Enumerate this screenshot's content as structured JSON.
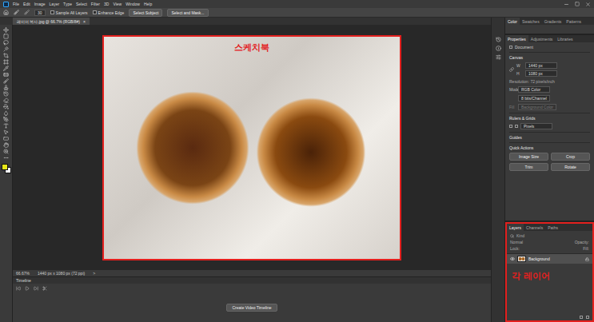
{
  "menu_bar": {
    "items": [
      "File",
      "Edit",
      "Image",
      "Layer",
      "Type",
      "Select",
      "Filter",
      "3D",
      "View",
      "Window",
      "Help"
    ]
  },
  "options_bar": {
    "size": "30",
    "checkboxes": [
      {
        "label": "Sample All Layers",
        "checked": false
      },
      {
        "label": "Enhance Edge",
        "checked": false
      }
    ],
    "buttons": [
      "Select Subject",
      "Select and Mask..."
    ]
  },
  "document_tab": {
    "title": "레이어 복사.jpg @ 66.7% (RGB/8#)",
    "close": "×"
  },
  "toolbar": {
    "swatches": [
      {
        "name": "foreground",
        "color": "#e6e619"
      },
      {
        "name": "background",
        "color": "#ffffff"
      }
    ]
  },
  "canvas": {
    "annotation": "스케치북"
  },
  "status_bar": {
    "zoom": "66.67%",
    "document_size": "1440 px x 1080 px (72 ppi)",
    "arrow": ">"
  },
  "timeline": {
    "title": "Timeline",
    "button": "Create Video Timeline"
  },
  "color_panel": {
    "tabs": [
      {
        "label": "Color",
        "selected": true
      },
      {
        "label": "Swatches",
        "selected": false
      },
      {
        "label": "Gradients",
        "selected": false
      },
      {
        "label": "Patterns",
        "selected": false
      }
    ]
  },
  "properties_panel": {
    "tabs": [
      {
        "label": "Properties",
        "selected": true
      },
      {
        "label": "Adjustments",
        "selected": false
      },
      {
        "label": "Libraries",
        "selected": false
      }
    ],
    "document_label": "Document",
    "canvas_section": {
      "title": "Canvas",
      "fields": [
        {
          "label": "W",
          "value": "1440 px"
        },
        {
          "label": "H",
          "value": "1080 px"
        }
      ],
      "resolution": "Resolution: 72 pixels/inch",
      "mode": {
        "label": "Mode",
        "value": "RGB Color"
      },
      "depth": "8 bits/Channel",
      "fill": {
        "label": "Fill",
        "value": "Background Color",
        "disabled": true
      }
    },
    "rulers_section": {
      "title": "Rulers & Grids",
      "unit": "Pixels"
    },
    "guides_section": {
      "title": "Guides"
    },
    "quick_actions": {
      "title": "Quick Actions",
      "buttons": [
        "Image Size",
        "Crop",
        "Trim",
        "Rotate"
      ]
    }
  },
  "layers_panel": {
    "tabs": [
      {
        "label": "Layers",
        "selected": true
      },
      {
        "label": "Channels",
        "selected": false
      },
      {
        "label": "Paths",
        "selected": false
      }
    ],
    "filter": "Kind",
    "blend_mode": "Normal",
    "opacity_label": "Opacity:",
    "lock_label": "Lock:",
    "fill_label": "Fill:",
    "layers": [
      {
        "name": "Background",
        "visible": true,
        "selected": true,
        "locked": true
      }
    ],
    "annotation": "각 레이어"
  }
}
